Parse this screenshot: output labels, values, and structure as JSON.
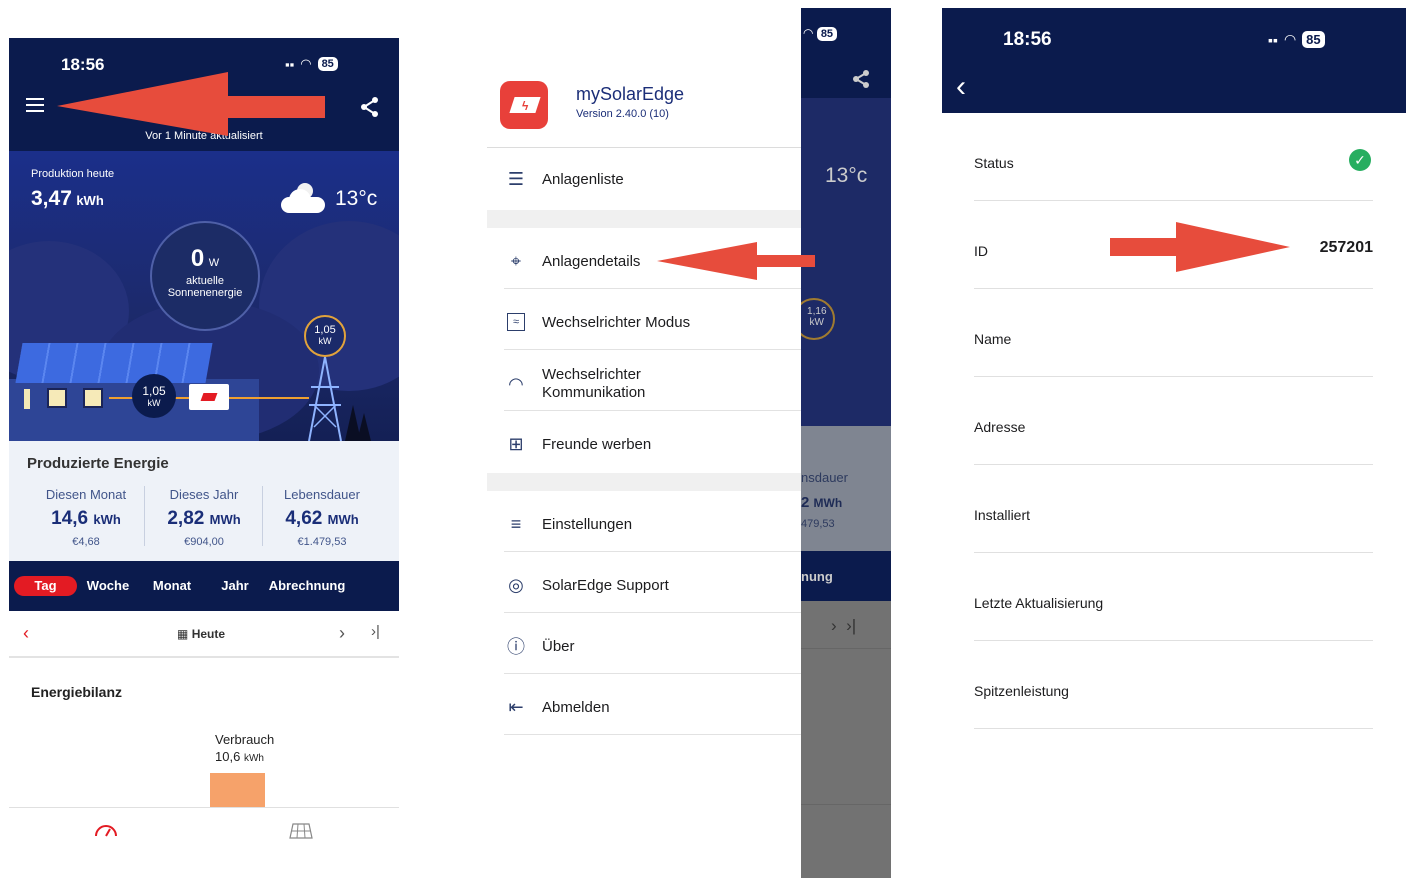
{
  "status_bar": {
    "time": "18:56",
    "battery": "85"
  },
  "screen1": {
    "updated": "Vor 1 Minute aktualisiert",
    "production_label": "Produktion heute",
    "production_value": "3,47",
    "production_unit": "kWh",
    "temperature": "13°c",
    "current_power_value": "0",
    "current_power_unit": "W",
    "current_power_label1": "aktuelle",
    "current_power_label2": "Sonnenenergie",
    "grid_value": "1,05",
    "grid_unit": "kW",
    "house_value": "1,05",
    "house_unit": "kW",
    "produced_title": "Produzierte Energie",
    "produced": [
      {
        "label": "Diesen Monat",
        "value": "14,6",
        "unit": "kWh",
        "eur": "€4,68"
      },
      {
        "label": "Dieses Jahr",
        "value": "2,82",
        "unit": "MWh",
        "eur": "€904,00"
      },
      {
        "label": "Lebensdauer",
        "value": "4,62",
        "unit": "MWh",
        "eur": "€1.479,53"
      }
    ],
    "tabs": [
      "Tag",
      "Woche",
      "Monat",
      "Jahr",
      "Abrechnung"
    ],
    "active_tab": "Tag",
    "date_label": "Heute",
    "balance_title": "Energiebilanz",
    "consumption_label": "Verbrauch",
    "consumption_value": "10,6",
    "consumption_unit": "kWh"
  },
  "screen2": {
    "app_name": "mySolarEdge",
    "version": "Version 2.40.0 (10)",
    "menu_group1": [
      "Anlagenliste"
    ],
    "menu_group2": [
      "Anlagendetails",
      "Wechselrichter Modus",
      "Wechselrichter Kommunikation",
      "Freunde werben"
    ],
    "menu_group3": [
      "Einstellungen",
      "SolarEdge Support",
      "Über",
      "Abmelden"
    ],
    "bg_temperature": "13°c",
    "bg_power_value": "1,16",
    "bg_power_unit": "kW",
    "bg_lifetime_label": "nsdauer",
    "bg_lifetime_value": "2",
    "bg_lifetime_unit": "MWh",
    "bg_lifetime_eur": "479,53",
    "bg_tab": "nung"
  },
  "screen3": {
    "rows": [
      {
        "label": "Status",
        "value": ""
      },
      {
        "label": "ID",
        "value": "257201"
      },
      {
        "label": "Name",
        "value": ""
      },
      {
        "label": "Adresse",
        "value": ""
      },
      {
        "label": "Installiert",
        "value": ""
      },
      {
        "label": "Letzte Aktualisierung",
        "value": ""
      },
      {
        "label": "Spitzenleistung",
        "value": ""
      }
    ]
  },
  "colors": {
    "navy": "#0b1b4d",
    "brand_red": "#e31b23",
    "annotation_red": "#e74c3c",
    "status_green": "#27ae60",
    "consumption_orange": "#f6a26a"
  }
}
